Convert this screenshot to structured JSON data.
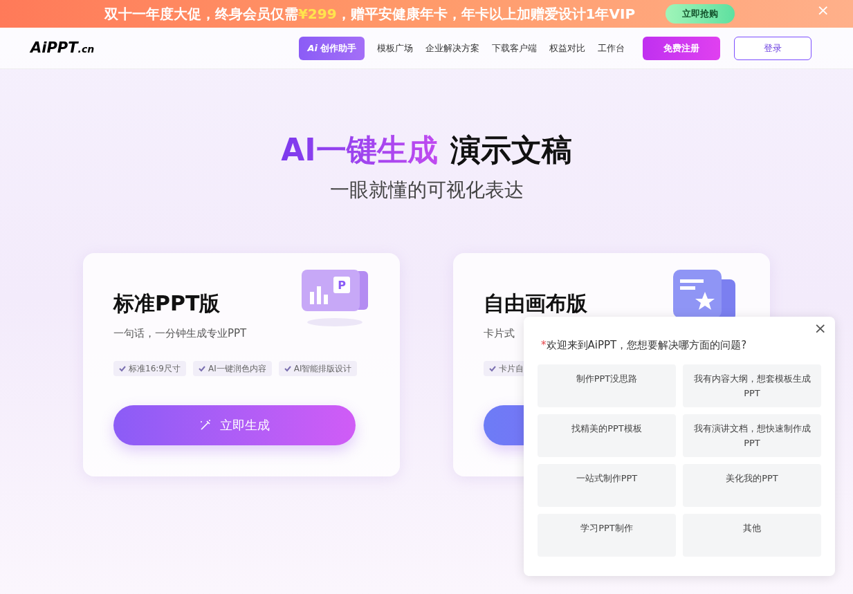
{
  "banner": {
    "text_before": "双十一年度大促，终身会员仅需",
    "price": "¥299",
    "text_after": "，赠平安健康年卡，年卡以上加赠爱设计1年VIP",
    "button": "立即抢购",
    "close": "×"
  },
  "nav": {
    "logo": {
      "main": "AiPPT",
      "suffix": ".cn"
    },
    "ai_button": {
      "badge": "Ai",
      "label": "创作助手"
    },
    "links": [
      "模板广场",
      "企业解决方案",
      "下载客户端",
      "权益对比",
      "工作台"
    ],
    "register": "免费注册",
    "login": "登录"
  },
  "hero": {
    "title_highlight": "AI一键生成",
    "title_rest": "演示文稿",
    "subtitle": "一眼就懂的可视化表达"
  },
  "cards": [
    {
      "title": "标准PPT版",
      "description": "一句话，一分钟生成专业PPT",
      "features": [
        "标准16:9尺寸",
        "AI一键润色内容",
        "AI智能排版设计"
      ],
      "button": "立即生成",
      "icon_letter": "P",
      "kind": "ppt"
    },
    {
      "title": "自由画布版",
      "description": "卡片式",
      "features": [
        "卡片自"
      ],
      "kind": "canvas"
    }
  ],
  "popup": {
    "close": "×",
    "required_mark": "*",
    "question": "欢迎来到AiPPT，您想要解决哪方面的问题?",
    "options": [
      "制作PPT没思路",
      "我有内容大纲，想套模板生成PPT",
      "找精美的PPT模板",
      "我有演讲文档，想快速制作成PPT",
      "一站式制作PPT",
      "美化我的PPT",
      "学习PPT制作",
      "其他"
    ]
  }
}
